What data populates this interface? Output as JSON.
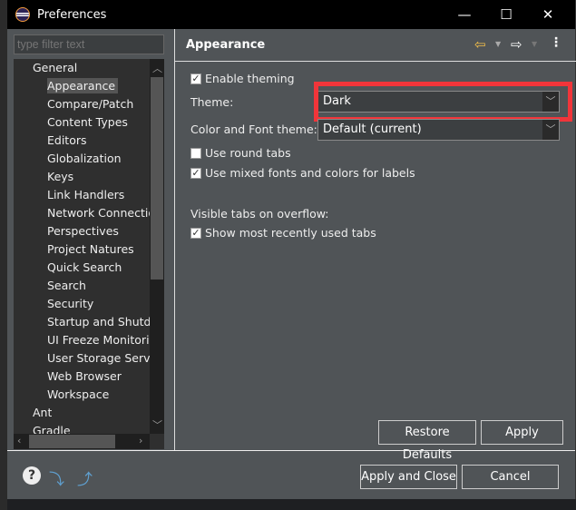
{
  "window": {
    "title": "Preferences",
    "controls": [
      "—",
      "☐",
      "✕"
    ]
  },
  "filter": {
    "placeholder": "type filter text"
  },
  "tree": [
    {
      "label": "General",
      "level": 0,
      "expanded": true
    },
    {
      "label": "Appearance",
      "level": 1,
      "expandable": true,
      "selected": true
    },
    {
      "label": "Compare/Patch",
      "level": 1
    },
    {
      "label": "Content Types",
      "level": 1
    },
    {
      "label": "Editors",
      "level": 1,
      "expandable": true
    },
    {
      "label": "Globalization",
      "level": 1
    },
    {
      "label": "Keys",
      "level": 1
    },
    {
      "label": "Link Handlers",
      "level": 1
    },
    {
      "label": "Network Connectio",
      "level": 1,
      "expandable": true
    },
    {
      "label": "Perspectives",
      "level": 1
    },
    {
      "label": "Project Natures",
      "level": 1
    },
    {
      "label": "Quick Search",
      "level": 1
    },
    {
      "label": "Search",
      "level": 1
    },
    {
      "label": "Security",
      "level": 1,
      "expandable": true
    },
    {
      "label": "Startup and Shutdo",
      "level": 1,
      "expandable": true
    },
    {
      "label": "UI Freeze Monitorin",
      "level": 1
    },
    {
      "label": "User Storage Servic",
      "level": 1,
      "expandable": true
    },
    {
      "label": "Web Browser",
      "level": 1
    },
    {
      "label": "Workspace",
      "level": 1,
      "expandable": true
    },
    {
      "label": "Ant",
      "level": 0,
      "expandable": true
    },
    {
      "label": "Gradle",
      "level": 0,
      "expandable": true
    }
  ],
  "page": {
    "title": "Appearance",
    "enable_theming": {
      "label": "Enable theming",
      "checked": true
    },
    "theme": {
      "label": "Theme:",
      "value": "Dark"
    },
    "color_font_theme": {
      "label": "Color and Font theme:",
      "value": "Default (current)"
    },
    "round_tabs": {
      "label": "Use round tabs",
      "checked": false
    },
    "mixed_fonts": {
      "label": "Use mixed fonts and colors for labels",
      "checked": true
    },
    "visible_tabs_label": "Visible tabs on overflow:",
    "recent_tabs": {
      "label": "Show most recently used tabs",
      "checked": true
    },
    "restore_defaults": "Restore Defaults",
    "apply": "Apply"
  },
  "footer": {
    "apply_close": "Apply and Close",
    "cancel": "Cancel"
  },
  "colors": {
    "highlight": "#f1353a",
    "back_arrow": "#f5c04a"
  }
}
